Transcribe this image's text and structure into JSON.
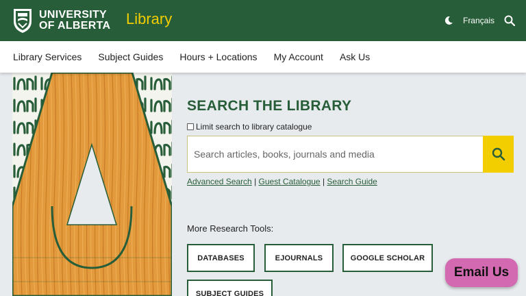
{
  "header": {
    "university_line1": "UNIVERSITY",
    "university_line2": "OF ALBERTA",
    "site_title": "Library",
    "language_link": "Français"
  },
  "nav": {
    "items": [
      "Library Services",
      "Subject Guides",
      "Hours + Locations",
      "My Account",
      "Ask Us"
    ]
  },
  "search": {
    "title": "SEARCH THE LIBRARY",
    "limit_label": "Limit search to library catalogue",
    "placeholder": "Search articles, books, journals and media",
    "links": [
      "Advanced Search",
      "Guest Catalogue",
      "Search Guide"
    ],
    "separator": "|"
  },
  "tools": {
    "heading": "More Research Tools:",
    "buttons": [
      "DATABASES",
      "EJOURNALS",
      "GOOGLE SCHOLAR",
      "SUBJECT GUIDES"
    ]
  },
  "chat": {
    "label": "Email Us"
  },
  "colors": {
    "brand_green": "#275d38",
    "brand_gold": "#f2cd00",
    "chat_pink": "#d36ab1"
  }
}
